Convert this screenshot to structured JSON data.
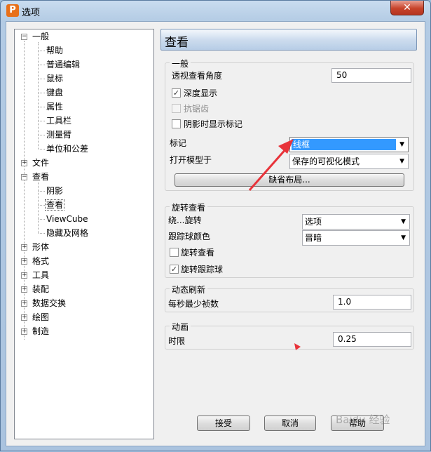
{
  "window": {
    "title": "选项",
    "icon_letter": "P",
    "close_glyph": "✕"
  },
  "tree": {
    "collapse_glyph": "−",
    "expand_glyph": "+",
    "general": {
      "label": "一般",
      "children": [
        "帮助",
        "普通编辑",
        "鼠标",
        "键盘",
        "属性",
        "工具栏",
        "测量臂",
        "单位和公差"
      ]
    },
    "file": "文件",
    "view": {
      "label": "查看",
      "children": [
        "阴影",
        "查看",
        "ViewCube",
        "隐藏及网格"
      ]
    },
    "rest": [
      "形体",
      "格式",
      "工具",
      "装配",
      "数据交换",
      "绘图",
      "制造"
    ]
  },
  "pane": {
    "title": "查看",
    "general": {
      "title": "一般",
      "perspective_label": "透视查看角度",
      "perspective_value": "50",
      "depth_label": "深度显示",
      "depth_checked": true,
      "antialias_label": "抗锯齿",
      "antialias_checked": false,
      "shadow_marker_label": "阴影时显示标记",
      "shadow_marker_checked": false,
      "marker_label": "标记",
      "marker_value": "线框",
      "open_model_label": "打开模型于",
      "open_model_value": "保存的可视化模式",
      "default_layout_button": "缺省布局..."
    },
    "rotate": {
      "title": "旋转查看",
      "around_label": "绕...旋转",
      "around_value": "选项",
      "trackball_color_label": "跟踪球颜色",
      "trackball_color_value": "晋暗",
      "rotate_view_label": "旋转查看",
      "rotate_view_checked": false,
      "rotate_trackball_label": "旋转跟踪球",
      "rotate_trackball_checked": true
    },
    "refresh": {
      "title": "动态刷新",
      "min_fps_label": "每秒最少祯数",
      "min_fps_value": "1.0"
    },
    "animation": {
      "title": "动画",
      "duration_label": "时限",
      "duration_value": "0.25"
    }
  },
  "buttons": {
    "ok": "接受",
    "cancel": "取消",
    "help": "帮助"
  },
  "watermark": "Baidu 经验",
  "colors": {
    "annotation_arrow": "#e8333a",
    "selection": "#3399ff"
  }
}
